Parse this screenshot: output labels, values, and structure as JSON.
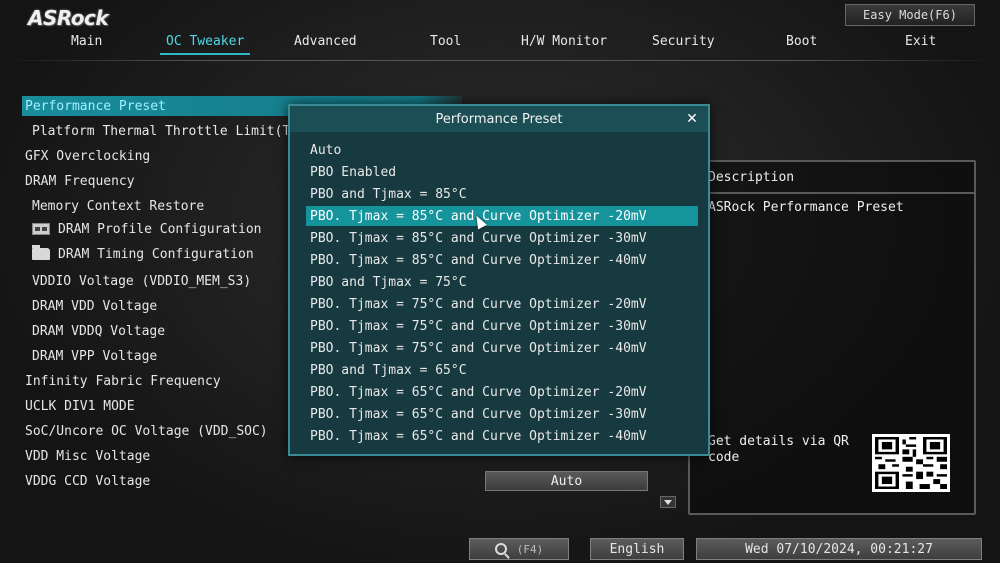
{
  "brand": "ASRock",
  "easy_mode": "Easy Mode(F6)",
  "tabs": [
    {
      "label": "Main"
    },
    {
      "label": "OC Tweaker"
    },
    {
      "label": "Advanced"
    },
    {
      "label": "Tool"
    },
    {
      "label": "H/W Monitor"
    },
    {
      "label": "Security"
    },
    {
      "label": "Boot"
    },
    {
      "label": "Exit"
    }
  ],
  "active_tab": "OC Tweaker",
  "menu": [
    {
      "label": "Performance Preset"
    },
    {
      "label": "Platform Thermal Throttle Limit(TCTL)"
    },
    {
      "label": "GFX Overclocking"
    },
    {
      "label": "DRAM Frequency"
    },
    {
      "label": "Memory Context Restore"
    },
    {
      "label": "DRAM Profile Configuration",
      "icon": "memory-chip-icon"
    },
    {
      "label": "DRAM Timing Configuration",
      "icon": "folder-icon"
    },
    {
      "label": "VDDIO Voltage (VDDIO_MEM_S3)"
    },
    {
      "label": "DRAM VDD Voltage"
    },
    {
      "label": "DRAM VDDQ Voltage"
    },
    {
      "label": "DRAM VPP Voltage"
    },
    {
      "label": "Infinity Fabric Frequency"
    },
    {
      "label": "UCLK DIV1 MODE"
    },
    {
      "label": "SoC/Uncore OC Voltage (VDD_SOC)"
    },
    {
      "label": "VDD Misc Voltage"
    },
    {
      "label": "VDDG CCD Voltage"
    }
  ],
  "vddg_ccd_value": "Auto",
  "popup": {
    "title": "Performance Preset",
    "options": [
      "Auto",
      "PBO Enabled",
      "PBO and Tjmax = 85°C",
      "PBO. Tjmax = 85°C and Curve Optimizer -20mV",
      "PBO. Tjmax = 85°C and Curve Optimizer -30mV",
      "PBO. Tjmax = 85°C and Curve Optimizer -40mV",
      "PBO and Tjmax = 75°C",
      "PBO. Tjmax = 75°C and Curve Optimizer -20mV",
      "PBO. Tjmax = 75°C and Curve Optimizer -30mV",
      "PBO. Tjmax = 75°C and Curve Optimizer -40mV",
      "PBO and Tjmax = 65°C",
      "PBO. Tjmax = 65°C and Curve Optimizer -20mV",
      "PBO. Tjmax = 65°C and Curve Optimizer -30mV",
      "PBO. Tjmax = 65°C and Curve Optimizer -40mV"
    ],
    "selected_index": 3
  },
  "description": {
    "header": "Description",
    "text": "ASRock Performance Preset",
    "qr_text": "Get details via QR code"
  },
  "bottom": {
    "search_key": "(F4)",
    "language": "English",
    "datetime": "Wed 07/10/2024, 00:21:27"
  },
  "colors": {
    "accent": "#2fb8c8",
    "popup_bg": "#173a40",
    "selection": "#16949c"
  }
}
